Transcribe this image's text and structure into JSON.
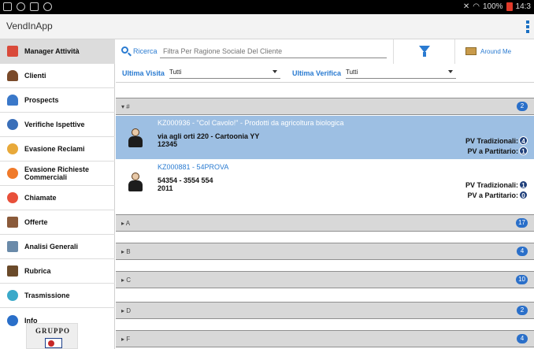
{
  "statusbar": {
    "battery": "100%",
    "time": "14:3"
  },
  "app": {
    "title": "VendInApp"
  },
  "sidebar": {
    "items": [
      {
        "label": "Manager Attività",
        "icon": "calendar-icon",
        "color": "#d94a3a",
        "active": true
      },
      {
        "label": "Clienti",
        "icon": "client-person-icon",
        "color": "#7a4a2a",
        "active": false
      },
      {
        "label": "Prospects",
        "icon": "prospect-person-icon",
        "color": "#3a78c9",
        "active": false
      },
      {
        "label": "Verifiche Ispettive",
        "icon": "inspection-icon",
        "color": "#3a6fb9",
        "active": false
      },
      {
        "label": "Evasione Reclami",
        "icon": "complaint-icon",
        "color": "#e8a93a",
        "active": false
      },
      {
        "label": "Evasione Richieste\nCommerciali",
        "icon": "commercial-request-icon",
        "color": "#f07a2a",
        "active": false
      },
      {
        "label": "Chiamate",
        "icon": "call-icon",
        "color": "#e8503a",
        "active": false
      },
      {
        "label": "Offerte",
        "icon": "offer-icon",
        "color": "#8a5a3a",
        "active": false
      },
      {
        "label": "Analisi Generali",
        "icon": "analysis-icon",
        "color": "#6a8aa9",
        "active": false
      },
      {
        "label": "Rubrica",
        "icon": "address-book-icon",
        "color": "#6a4a2a",
        "active": false
      },
      {
        "label": "Trasmissione",
        "icon": "transmission-icon",
        "color": "#3aa9c9",
        "active": false
      },
      {
        "label": "Info",
        "icon": "info-icon",
        "color": "#2a6fc9",
        "active": false
      }
    ],
    "logo_text": "GRUPPO"
  },
  "search": {
    "label": "Ricerca",
    "placeholder": "Filtra Per Ragione Sociale Del Cliente",
    "around_label": "Around Me"
  },
  "filters": {
    "last_visit_label": "Ultima Visita",
    "last_visit_value": "Tutti",
    "last_check_label": "Ultima Verifica",
    "last_check_value": "Tutti"
  },
  "groups": [
    {
      "label": "▾ #",
      "count": "2"
    },
    {
      "label": "▸ A",
      "count": "17"
    },
    {
      "label": "▸ B",
      "count": "4"
    },
    {
      "label": "▸ C",
      "count": "10"
    },
    {
      "label": "▸ D",
      "count": "2"
    },
    {
      "label": "▸ F",
      "count": "4"
    }
  ],
  "clients": [
    {
      "title": "KZ000936 - \"Col Cavolo!\" - Prodotti da agricoltura biologica",
      "address": "via agli orti 220 -  Cartoonia YY",
      "sub": "12345",
      "pv_trad_label": "PV Tradizionali:",
      "pv_trad": "4",
      "pv_part_label": "PV a Partitario:",
      "pv_part": "1",
      "selected": true
    },
    {
      "title": "KZ000881 - 54PROVA",
      "address": "54354 -  3554 554",
      "sub": "2011",
      "pv_trad_label": "PV Tradizionali:",
      "pv_trad": "1",
      "pv_part_label": "PV a Partitario:",
      "pv_part": "0",
      "selected": false
    }
  ]
}
